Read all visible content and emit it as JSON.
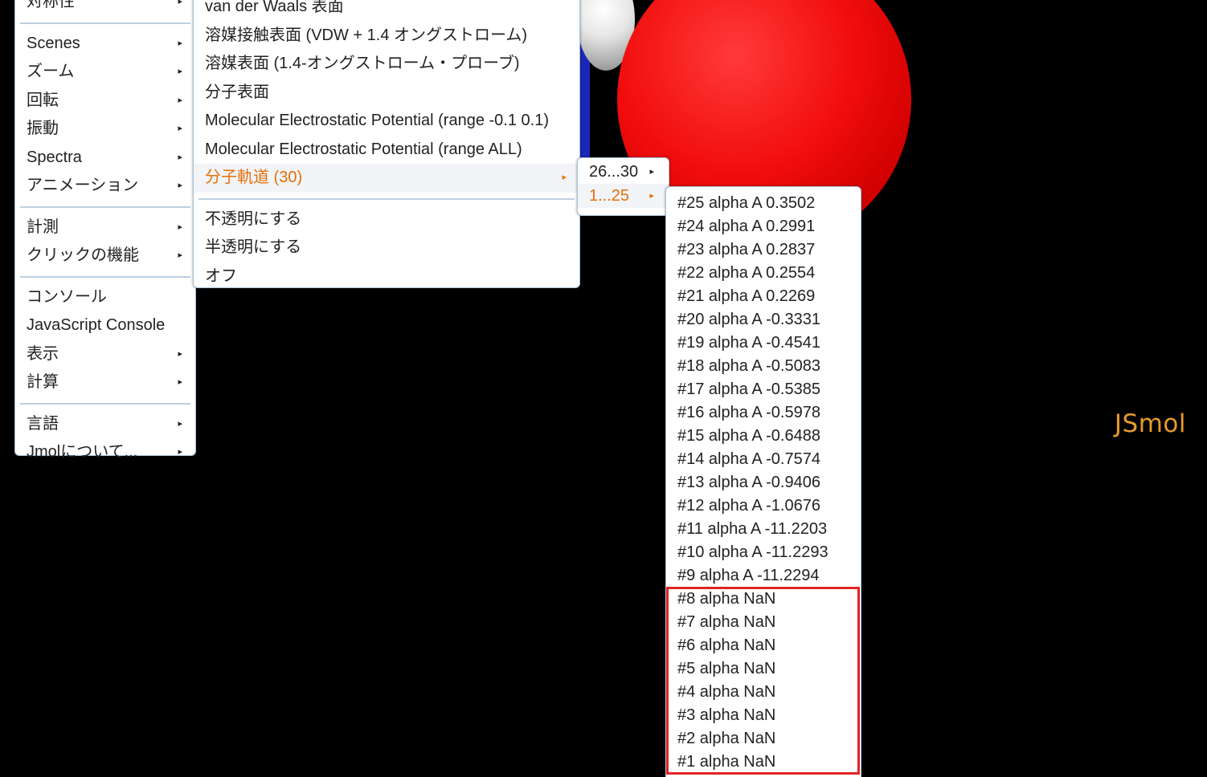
{
  "viewer": {
    "logo": "JSmol",
    "colors": {
      "background": "#000000",
      "oxygen": "#f20d0d",
      "hydrogen": "#d8d8d8",
      "nitrogen": "#1b27b8",
      "logo": "#e89a2a"
    }
  },
  "menu_main": {
    "items": [
      {
        "label": "対称性",
        "submenu": true
      },
      {
        "separator": true
      },
      {
        "label": "Scenes",
        "submenu": true
      },
      {
        "label": "ズーム",
        "submenu": true
      },
      {
        "label": "回転",
        "submenu": true
      },
      {
        "label": "振動",
        "submenu": true
      },
      {
        "label": "Spectra",
        "submenu": true
      },
      {
        "label": "アニメーション",
        "submenu": true
      },
      {
        "separator": true
      },
      {
        "label": "計測",
        "submenu": true
      },
      {
        "label": "クリックの機能",
        "submenu": true
      },
      {
        "separator": true
      },
      {
        "label": "コンソール",
        "submenu": false
      },
      {
        "label": "JavaScript Console",
        "submenu": false
      },
      {
        "label": "表示",
        "submenu": true
      },
      {
        "label": "計算",
        "submenu": true
      },
      {
        "separator": true
      },
      {
        "label": "言語",
        "submenu": true
      },
      {
        "label": "Jmolについて...",
        "submenu": true
      }
    ]
  },
  "menu_surface": {
    "items": [
      {
        "label": "van der Waals 表面"
      },
      {
        "label": "溶媒接触表面 (VDW + 1.4 オングストローム)"
      },
      {
        "label": "溶媒表面 (1.4-オングストローム・プローブ)"
      },
      {
        "label": "分子表面"
      },
      {
        "label": "Molecular Electrostatic Potential (range -0.1 0.1)"
      },
      {
        "label": "Molecular Electrostatic Potential (range ALL)"
      },
      {
        "label": "分子軌道 (30)",
        "submenu": true,
        "active": true
      },
      {
        "separator": true
      },
      {
        "label": "不透明にする"
      },
      {
        "label": "半透明にする"
      },
      {
        "label": "オフ"
      }
    ]
  },
  "menu_mo_ranges": {
    "items": [
      {
        "label": "26...30",
        "submenu": true
      },
      {
        "label": "1...25",
        "submenu": true,
        "active": true
      }
    ]
  },
  "menu_orbitals": {
    "items": [
      "#25 alpha A 0.3502",
      "#24 alpha A 0.2991",
      "#23 alpha A 0.2837",
      "#22 alpha A 0.2554",
      "#21 alpha A 0.2269",
      "#20 alpha A -0.3331",
      "#19 alpha A -0.4541",
      "#18 alpha A -0.5083",
      "#17 alpha A -0.5385",
      "#16 alpha A -0.5978",
      "#15 alpha A -0.6488",
      "#14 alpha A -0.7574",
      "#13 alpha A -0.9406",
      "#12 alpha A -1.0676",
      "#11 alpha A -11.2203",
      "#10 alpha A -11.2293",
      "#9 alpha A -11.2294",
      "#8 alpha NaN",
      "#7 alpha NaN",
      "#6 alpha NaN",
      "#5 alpha NaN",
      "#4 alpha NaN",
      "#3 alpha NaN",
      "#2 alpha NaN",
      "#1 alpha NaN"
    ]
  }
}
